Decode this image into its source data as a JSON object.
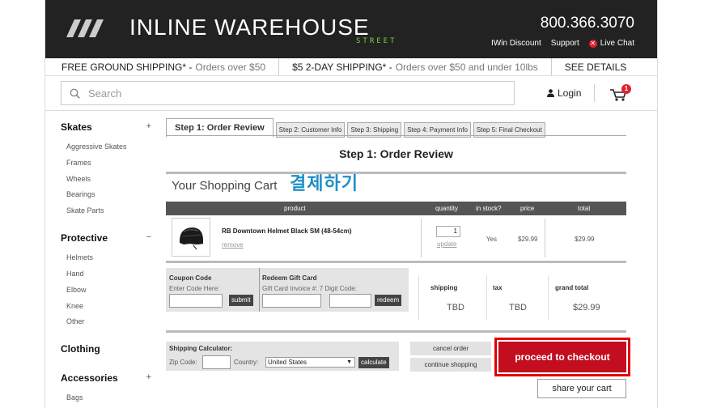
{
  "header": {
    "logo_text": "INLINE WAREHOUSE",
    "logo_sub": "STREET",
    "phone": "800.366.3070",
    "links": [
      "IWin Discount",
      "Support",
      "Live Chat"
    ]
  },
  "shipping_banner": [
    {
      "bold": "FREE GROUND SHIPPING* -",
      "note": "Orders over $50"
    },
    {
      "bold": "$5 2-DAY SHIPPING* -",
      "note": "Orders over $50 and under 10lbs"
    },
    {
      "bold": "SEE DETAILS",
      "note": ""
    }
  ],
  "search": {
    "placeholder": "Search"
  },
  "account": {
    "login": "Login",
    "cart_count": "1"
  },
  "sidebar": {
    "categories": [
      {
        "label": "Skates",
        "toggle": "+",
        "items": [
          "Aggressive Skates",
          "Frames",
          "Wheels",
          "Bearings",
          "Skate Parts"
        ]
      },
      {
        "label": "Protective",
        "toggle": "−",
        "items": [
          "Helmets",
          "Hand",
          "Elbow",
          "Knee",
          "Other"
        ]
      },
      {
        "label": "Clothing",
        "toggle": "",
        "items": []
      },
      {
        "label": "Accessories",
        "toggle": "+",
        "items": [
          "Bags"
        ]
      }
    ]
  },
  "tabs": [
    "Step 1: Order Review",
    "Step 2: Customer Info",
    "Step 3: Shipping",
    "Step 4: Payment Info",
    "Step 5: Final Checkout"
  ],
  "page_title": "Step 1: Order Review",
  "cart": {
    "title": "Your Shopping Cart",
    "overlay_text": "결제하기",
    "columns": [
      "product",
      "quantity",
      "in stock?",
      "price",
      "total"
    ],
    "item": {
      "name": "RB Downtown Helmet Black SM (48-54cm)",
      "remove": "remove",
      "quantity": "1",
      "update": "update",
      "in_stock": "Yes",
      "price": "$29.99",
      "total": "$29.99"
    }
  },
  "coupon": {
    "coupon_label": "Coupon Code",
    "coupon_sub": "Enter Code Here:",
    "coupon_btn": "submit",
    "gift_label": "Redeem Gift Card",
    "gift_sub": "Gift Card Invoice #:  7 Digit Code:",
    "gift_btn": "redeem"
  },
  "summary": {
    "shipping_label": "shipping",
    "shipping": "TBD",
    "tax_label": "tax",
    "tax": "TBD",
    "grand_label": "grand total",
    "grand": "$29.99"
  },
  "ship_calc": {
    "title": "Shipping Calculator:",
    "zip_label": "Zip Code:",
    "country_label": "Country:",
    "country": "United States",
    "btn": "calculate"
  },
  "actions": {
    "cancel": "cancel order",
    "continue": "continue shopping",
    "checkout": "proceed to checkout",
    "share": "share your cart"
  }
}
